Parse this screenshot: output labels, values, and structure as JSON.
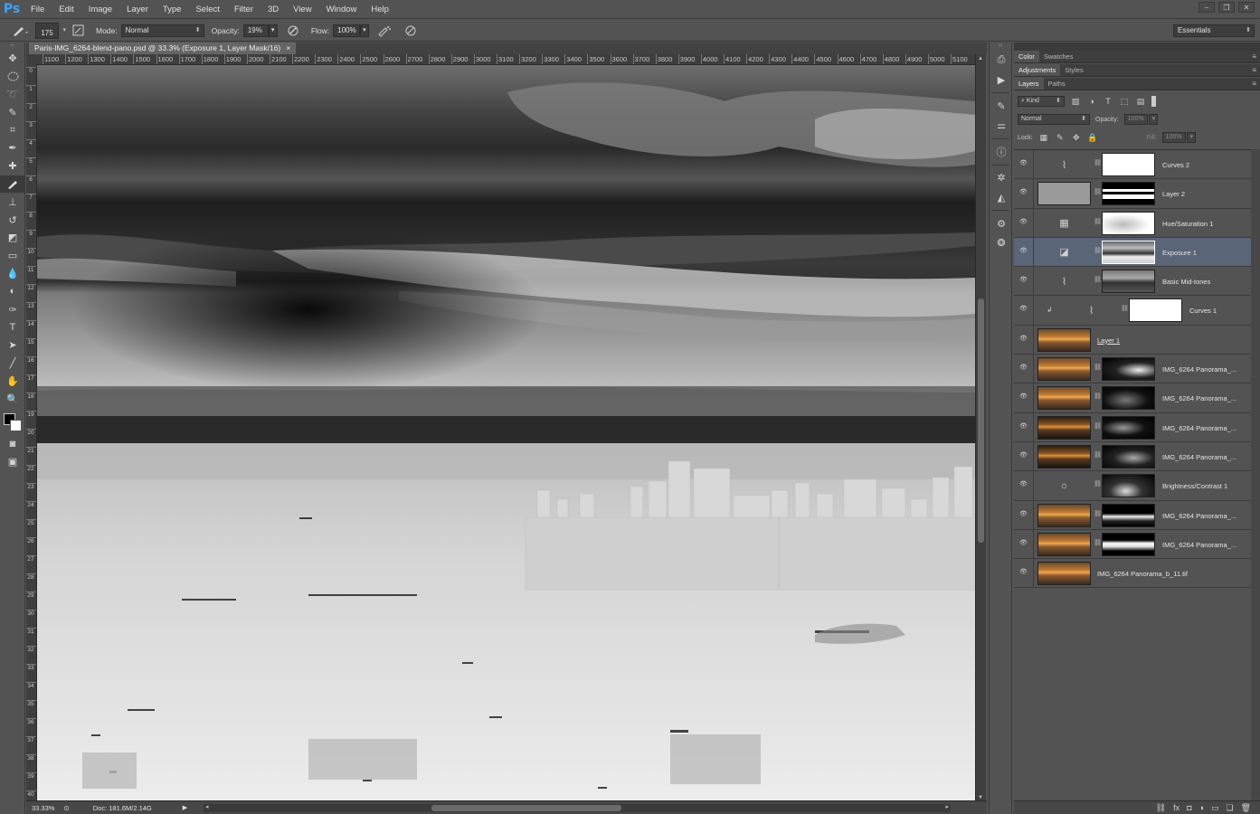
{
  "app": {
    "logo": "Ps"
  },
  "menu": [
    "File",
    "Edit",
    "Image",
    "Layer",
    "Type",
    "Select",
    "Filter",
    "3D",
    "View",
    "Window",
    "Help"
  ],
  "options": {
    "brush_size": "175",
    "mode_label": "Mode:",
    "mode_value": "Normal",
    "opacity_label": "Opacity:",
    "opacity_value": "19%",
    "flow_label": "Flow:",
    "flow_value": "100%",
    "workspace": "Essentials"
  },
  "document": {
    "tab_title": "Paris-IMG_6264-blend-pano.psd @ 33.3% (Exposure 1, Layer Mask/16)",
    "close_glyph": "×",
    "zoom": "33.33%",
    "doc_info": "Doc: 181.6M/2.14G"
  },
  "ruler": {
    "h_labels": [
      "1100",
      "1200",
      "1300",
      "1400",
      "1500",
      "1600",
      "1700",
      "1800",
      "1900",
      "2000",
      "2100",
      "2200",
      "2300",
      "2400",
      "2500",
      "2600",
      "2700",
      "2800",
      "2900",
      "3000",
      "3100",
      "3200",
      "3300",
      "3400",
      "3500",
      "3600",
      "3700",
      "3800",
      "3900",
      "4000",
      "4100",
      "4200",
      "4300",
      "4400",
      "4500",
      "4600",
      "4700",
      "4800",
      "4900",
      "5000",
      "5100"
    ],
    "v_labels": [
      "0",
      "1",
      "2",
      "3",
      "4",
      "5",
      "6",
      "7",
      "8",
      "9",
      "10",
      "11",
      "12",
      "13",
      "14",
      "15",
      "16",
      "17",
      "18",
      "19",
      "20",
      "21",
      "22",
      "23",
      "24",
      "25",
      "26",
      "27",
      "28",
      "29",
      "30",
      "31",
      "32",
      "33",
      "34",
      "35",
      "36",
      "37",
      "38",
      "39",
      "40"
    ]
  },
  "panels": {
    "color_tabs": [
      "Color",
      "Swatches"
    ],
    "adj_tabs": [
      "Adjustments",
      "Styles"
    ],
    "layer_tabs": [
      "Layers",
      "Paths"
    ],
    "kind_label": "Kind",
    "blend_mode": "Normal",
    "opacity_label": "Opacity:",
    "opacity_value": "100%",
    "lock_label": "Lock:",
    "fill_label": "Fill:",
    "fill_value": "100%"
  },
  "layers": [
    {
      "name": "Curves 2",
      "type": "adjustment",
      "icon": "curves-icon",
      "mask": "white"
    },
    {
      "name": "Layer 2",
      "type": "pixel-gray",
      "mask": "mask-l2"
    },
    {
      "name": "Hue/Saturation 1",
      "type": "adjustment",
      "icon": "hue-saturation-icon",
      "mask": "mask-hue"
    },
    {
      "name": "Exposure 1",
      "type": "adjustment",
      "icon": "exposure-icon",
      "mask": "mask-exp",
      "selected": true
    },
    {
      "name": "Basic Mid-tones",
      "type": "adjustment",
      "icon": "curves-icon",
      "mask": "mask-mid"
    },
    {
      "name": "Curves 1",
      "type": "adjustment-clipped",
      "icon": "curves-icon",
      "mask": "white"
    },
    {
      "name": "Layer 1",
      "type": "pixel-photo",
      "underline": true
    },
    {
      "name": "IMG_6264 Panorama_...",
      "type": "pixel-photo",
      "mask": "mask-a"
    },
    {
      "name": "IMG_6264 Panorama_...",
      "type": "pixel-photo",
      "mask": "mask-b"
    },
    {
      "name": "IMG_6264 Panorama_...",
      "type": "pixel-photo-dark",
      "mask": "mask-c"
    },
    {
      "name": "IMG_6264 Panorama_...",
      "type": "pixel-photo-dark",
      "mask": "mask-d"
    },
    {
      "name": "Brightness/Contrast 1",
      "type": "adjustment",
      "icon": "brightness-icon",
      "mask": "mask-bc"
    },
    {
      "name": "IMG_6264 Panorama_...",
      "type": "pixel-photo",
      "mask": "mask-e"
    },
    {
      "name": "IMG_6264 Panorama_...",
      "type": "pixel-photo",
      "mask": "mask-f"
    },
    {
      "name": "IMG_6264 Panorama_b_11.tif",
      "type": "pixel-photo"
    }
  ]
}
